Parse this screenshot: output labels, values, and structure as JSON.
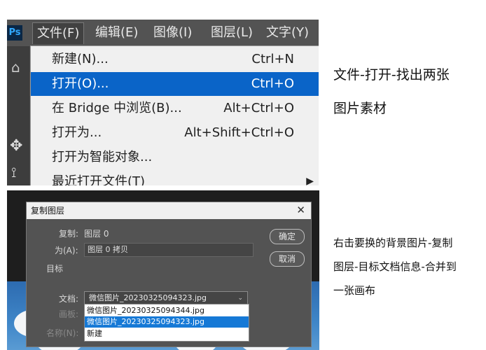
{
  "menubar": {
    "app_icon": "ps-logo",
    "app_text": "Ps",
    "items": [
      "文件(F)",
      "编辑(E)",
      "图像(I)",
      "图层(L)",
      "文字(Y)"
    ]
  },
  "file_menu": {
    "items": [
      {
        "label": "新建(N)...",
        "shortcut": "Ctrl+N"
      },
      {
        "label": "打开(O)...",
        "shortcut": "Ctrl+O"
      },
      {
        "label": "在 Bridge 中浏览(B)...",
        "shortcut": "Alt+Ctrl+O"
      },
      {
        "label": "打开为...",
        "shortcut": "Alt+Shift+Ctrl+O"
      },
      {
        "label": "打开为智能对象..."
      },
      {
        "label": "最近打开文件(T)"
      }
    ],
    "selected_index": 1
  },
  "caption_top": {
    "line1": "文件-打开-找出两张",
    "line2": "图片素材"
  },
  "dialog": {
    "title": "复制图层",
    "copy_label": "复制:",
    "copy_value": "图层 0",
    "as_label": "为(A):",
    "as_value": "图层 0 拷贝",
    "target_label": "目标",
    "doc_label": "文档:",
    "doc_value": "微信图片_20230325094323.jpg",
    "artboard_label": "画板:",
    "name_label": "名称(N):",
    "ok_button": "确定",
    "cancel_button": "取消",
    "doc_options": [
      "微信图片_20230325094344.jpg",
      "微信图片_20230325094323.jpg",
      "新建"
    ],
    "doc_selected_index": 1
  },
  "caption_bottom": {
    "line1": "右击要换的背景图片-复制",
    "line2": "图层-目标文档信息-合并到",
    "line3": "一张画布"
  }
}
